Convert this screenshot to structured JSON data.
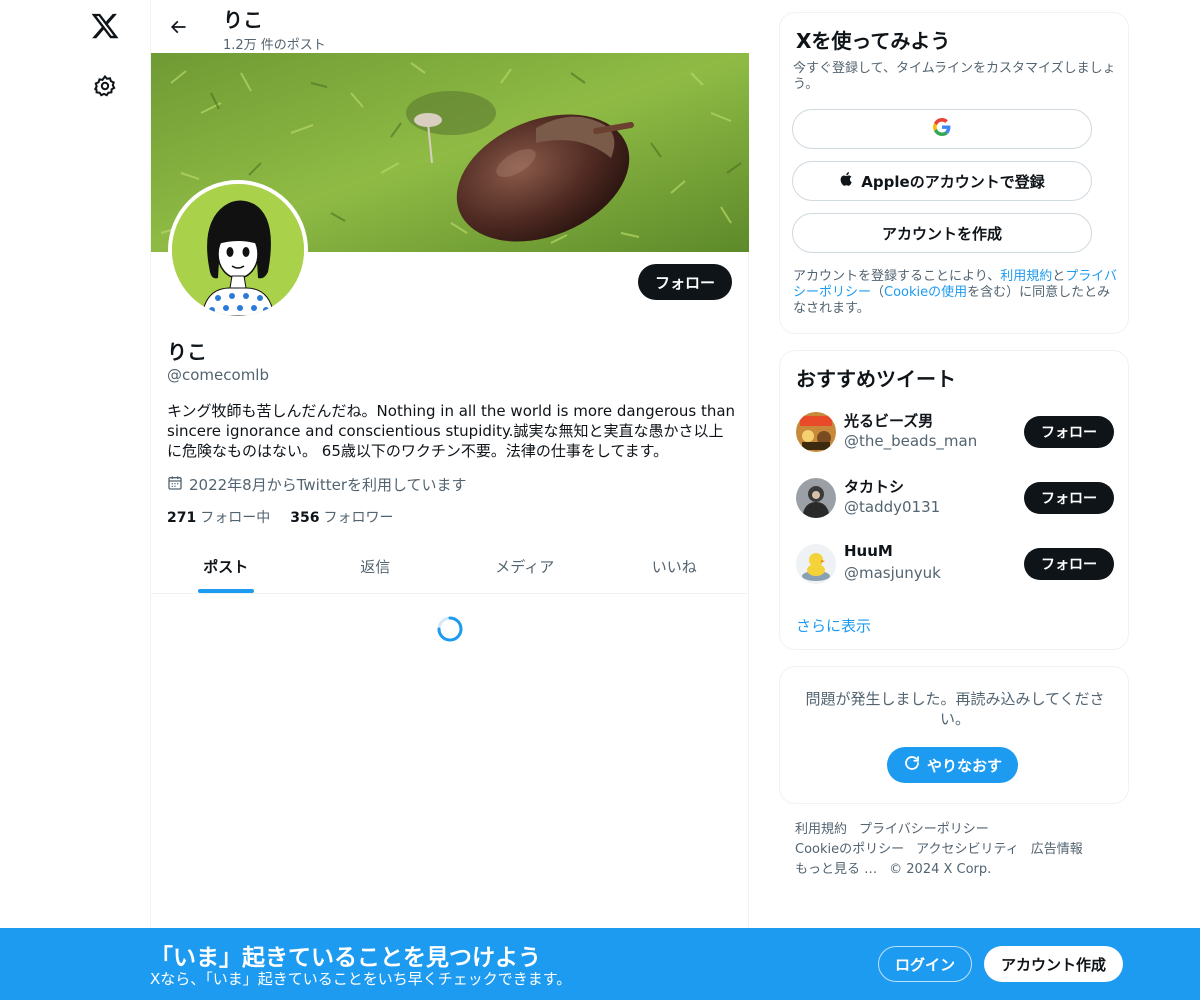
{
  "nav": {
    "x_icon": "x-logo-icon",
    "settings_icon": "gear-icon"
  },
  "header": {
    "name": "りこ",
    "post_count": "1.2万 件のポスト"
  },
  "profile": {
    "name": "りこ",
    "handle": "@comecomlb",
    "bio": "キング牧師も苦しんだんだね。Nothing in all the world is more dangerous than sincere ignorance and conscientious stupidity.誠実な無知と実直な愚かさ以上に危険なものはない。 65歳以下のワクチン不要。法律の仕事をしてます。",
    "joined": "2022年8月からTwitterを利用しています",
    "following_count": "271",
    "following_label": "フォロー中",
    "followers_count": "356",
    "followers_label": "フォロワー",
    "follow_label": "フォロー"
  },
  "tabs": [
    {
      "label": "ポスト",
      "active": true
    },
    {
      "label": "返信",
      "active": false
    },
    {
      "label": "メディア",
      "active": false
    },
    {
      "label": "いいね",
      "active": false
    }
  ],
  "signup_card": {
    "title": "Xを使ってみよう",
    "subtitle": "今すぐ登録して、タイムラインをカスタマイズしましょう。",
    "google_icon": "google-icon",
    "apple_label": "Appleのアカウントで登録",
    "create_label": "アカウントを作成",
    "legal_pre": "アカウントを登録することにより、",
    "legal_terms": "利用規約",
    "legal_and": "と",
    "legal_privacy": "プライバシーポリシー",
    "legal_paren_open": "（",
    "legal_cookie": "Cookieの使用",
    "legal_post": "を含む）に同意したとみなされます。"
  },
  "recommendations": {
    "title": "おすすめツイート",
    "items": [
      {
        "name": "光るビーズ男",
        "handle": "@the_beads_man",
        "follow": "フォロー"
      },
      {
        "name": "タカトシ",
        "handle": "@taddy0131",
        "follow": "フォロー"
      },
      {
        "name": "HuuM",
        "handle": "@masjunyuk",
        "follow": "フォロー"
      }
    ],
    "more": "さらに表示"
  },
  "error_card": {
    "message": "問題が発生しました。再読み込みしてください。",
    "retry": "やりなおす"
  },
  "footer": {
    "links": [
      "利用規約",
      "プライバシーポリシー",
      "Cookieのポリシー",
      "アクセシビリティ",
      "広告情報",
      "もっと見る …"
    ],
    "copyright": "© 2024 X Corp."
  },
  "bottom_banner": {
    "title": "「いま」起きていることを見つけよう",
    "subtitle": "Xなら、「いま」起きていることをいち早くチェックできます。",
    "login": "ログイン",
    "signup": "アカウント作成"
  },
  "colors": {
    "accent": "#1d9bf0",
    "dark": "#0f1419",
    "muted": "#536471"
  }
}
